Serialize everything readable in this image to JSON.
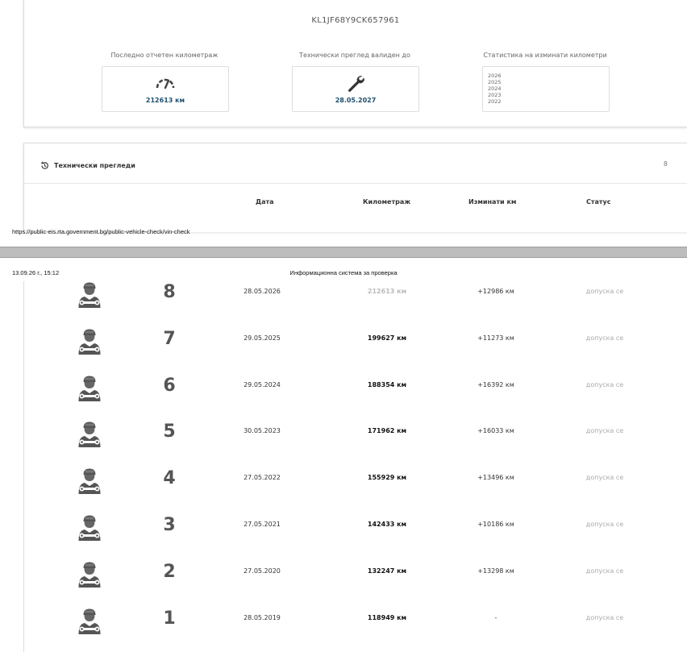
{
  "vehicle": {
    "vin": "KL1JF68Y9CK657961"
  },
  "stats": {
    "mileage_label": "Последно отчетен километраж",
    "mileage_value": "212613 км",
    "inspection_label": "Технически преглед валиден до",
    "inspection_value": "28.05.2027",
    "stats_label": "Статистика на изминати километри",
    "years": [
      "2026",
      "2025",
      "2024",
      "2023",
      "2022"
    ]
  },
  "section": {
    "title": "Технически прегледи",
    "count": "8",
    "columns": {
      "date": "Дата",
      "mileage": "Километраж",
      "traveled": "Изминати км",
      "status": "Статус"
    }
  },
  "print": {
    "url": "https://public-eis.rta.government.bg/public-vehicle-check/vin-check",
    "datetime": "13.09.26 г., 15:12",
    "title": "Информационна система за проверка"
  },
  "inspections": [
    {
      "number": "8",
      "date": "28.05.2026",
      "mileage": "212613 км",
      "traveled": "+12986 км",
      "status": "допуска се"
    },
    {
      "number": "7",
      "date": "29.05.2025",
      "mileage": "199627 км",
      "traveled": "+11273 км",
      "status": "допуска се"
    },
    {
      "number": "6",
      "date": "29.05.2024",
      "mileage": "188354 км",
      "traveled": "+16392 км",
      "status": "допуска се"
    },
    {
      "number": "5",
      "date": "30.05.2023",
      "mileage": "171962 км",
      "traveled": "+16033 км",
      "status": "допуска се"
    },
    {
      "number": "4",
      "date": "27.05.2022",
      "mileage": "155929 км",
      "traveled": "+13496 км",
      "status": "допуска се"
    },
    {
      "number": "3",
      "date": "27.05.2021",
      "mileage": "142433 км",
      "traveled": "+10186 км",
      "status": "допуска се"
    },
    {
      "number": "2",
      "date": "27.05.2020",
      "mileage": "132247 км",
      "traveled": "+13298 км",
      "status": "допуска се"
    },
    {
      "number": "1",
      "date": "28.05.2019",
      "mileage": "118949 км",
      "traveled": "-",
      "status": "допуска се"
    }
  ]
}
